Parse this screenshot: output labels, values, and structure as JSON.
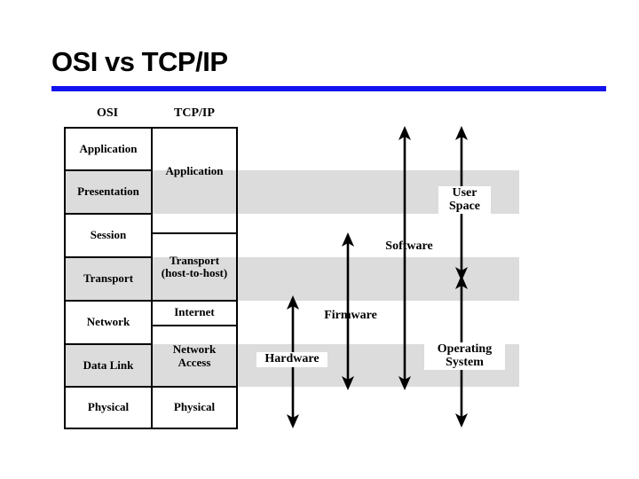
{
  "slide": {
    "title": "OSI vs TCP/IP",
    "accent_color": "#1313f0",
    "band_color": "#dcdcdc",
    "background": "#ffffff"
  },
  "columns": {
    "osi_caption": "OSI",
    "tcpip_caption": "TCP/IP"
  },
  "osi_layers": [
    {
      "label": "Application",
      "shaded": false
    },
    {
      "label": "Presentation",
      "shaded": true
    },
    {
      "label": "Session",
      "shaded": false
    },
    {
      "label": "Transport",
      "shaded": true
    },
    {
      "label": "Network",
      "shaded": false
    },
    {
      "label": "Data Link",
      "shaded": true
    },
    {
      "label": "Physical",
      "shaded": false
    }
  ],
  "tcpip_layers": [
    {
      "label": "",
      "shaded": false
    },
    {
      "label": "Application",
      "shaded": true
    },
    {
      "label": "",
      "shaded": false
    },
    {
      "label": "Transport\n(host-to-host)",
      "shaded": true
    },
    {
      "label": "Internet",
      "shaded": false
    },
    {
      "label": "Network\nAccess",
      "shaded": true
    },
    {
      "label": "Physical",
      "shaded": false
    }
  ],
  "tcpip_cells": [
    {
      "line1": "Application",
      "line2": ""
    },
    {
      "line1": "Transport",
      "line2": "(host-to-host)"
    },
    {
      "line1": "Internet",
      "line2": ""
    },
    {
      "line1": "Network",
      "line2": "Access"
    },
    {
      "line1": "Physical",
      "line2": ""
    }
  ],
  "annotations": [
    {
      "name": "hardware",
      "line1": "Hardware",
      "line2": "",
      "boxed": true
    },
    {
      "name": "firmware",
      "line1": "Firmware",
      "line2": "",
      "boxed": false
    },
    {
      "name": "software",
      "line1": "Software",
      "line2": "",
      "boxed": false
    },
    {
      "name": "user-space",
      "line1": "User",
      "line2": "Space",
      "boxed": true
    },
    {
      "name": "operating-system",
      "line1": "Operating",
      "line2": "System",
      "boxed": true
    }
  ]
}
